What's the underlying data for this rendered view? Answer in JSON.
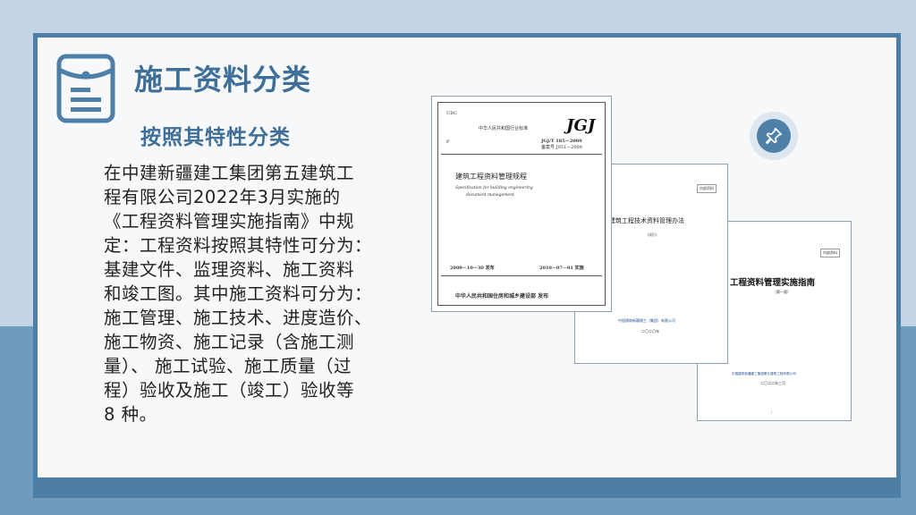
{
  "slide": {
    "title": "施工资料分类",
    "subtitle": "按照其特性分类",
    "body_lines": [
      "在中建新疆建工集团第五建筑工",
      "程有限公司2022年3月实施的",
      "《工程资料管理实施指南》中规",
      "定：工程资料按照其特性可分为：",
      "基建文件、监理资料、施工资料",
      "和竣工图。其中施工资料可分为：",
      "施工管理、施工技术、进度造价、",
      "施工物资、施工记录（含施工测",
      "量）、 施工试验、施工质量（过",
      "程）验收及施工（竣工）验收等",
      "8 种。"
    ]
  },
  "doc1": {
    "udc": "UDC",
    "issuer_top": "中华人民共和国行业标准",
    "mark": "JGJ",
    "p": "P",
    "code": "JGJ/T 185－2009",
    "record": "备案号 J951－2009",
    "title_cn": "建筑工程资料管理规程",
    "title_en1": "Specification for building engineering",
    "title_en2": "document management",
    "issued": "2009－10－30  发布",
    "effective": "2010－07－01  实施",
    "publisher": "中华人民共和国住房和城乡建设部  发布"
  },
  "doc2": {
    "title": "建筑工程技术资料管理办法",
    "sub": "（试行）",
    "company": "中国建筑新疆建工（集团）有限公司",
    "date": "二〇二〇年",
    "tag": "内部资料"
  },
  "doc3": {
    "title": "工程资料管理实施指南",
    "sub": "（第一版）",
    "company": "中国建筑新疆建工集团第五建筑工程有限公司",
    "date": "二〇二二年三月",
    "tag": "内部资料",
    "page": "i"
  },
  "icons": {
    "doc_icon": "document-icon",
    "pin_icon": "pushpin-icon"
  },
  "colors": {
    "accent": "#3f6f98",
    "frame": "#4d7ea6"
  }
}
